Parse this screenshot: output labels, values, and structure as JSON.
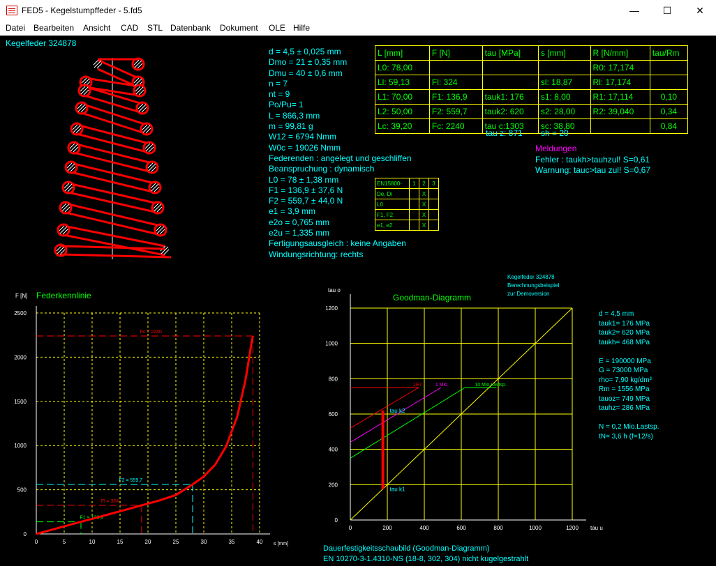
{
  "window": {
    "title": "FED5  -  Kegelstumpffeder  -  5.fd5",
    "minimize_glyph": "—",
    "maximize_glyph": "☐",
    "close_glyph": "✕"
  },
  "menu": [
    {
      "label": "Datei",
      "accel": "D"
    },
    {
      "label": "Bearbeiten",
      "accel": "B"
    },
    {
      "label": "Ansicht",
      "accel": "A"
    },
    {
      "label": "CAD",
      "accel": "C"
    },
    {
      "label": "STL",
      "accel": "S"
    },
    {
      "label": "Datenbank",
      "accel": ""
    },
    {
      "label": "Dokument",
      "accel": "D"
    },
    {
      "label": "OLE",
      "accel": "E"
    },
    {
      "label": "Hilfe",
      "accel": "H"
    }
  ],
  "spring_title": "Kegelfeder  324878",
  "results": [
    "d = 4,5 ± 0,025 mm",
    "Dmo = 21 ± 0,35 mm",
    "Dmu = 40 ± 0,6 mm",
    "n = 7",
    "nt = 9",
    "Po/Pu= 1",
    "L = 866,3 mm",
    "m = 99,81 g",
    "W12 = 6794 Nmm",
    "W0c = 19026 Nmm",
    "Federenden : angelegt und geschliffen",
    "Beanspruchung : dynamisch",
    "L0 = 78 ± 1,38 mm",
    "F1 = 136,9 ± 37,6 N",
    "F2 = 559,7 ± 44,0 N",
    "e1 = 3,9 mm",
    "e2o = 0,765 mm",
    "e2u = 1,335 mm",
    "Fertigungsausgleich : keine Angaben",
    "Windungsrichtung: rechts"
  ],
  "result_table": {
    "header": [
      "L [mm]",
      "F [N]",
      "tau [MPa]",
      "s [mm]",
      "R [N/mm]",
      "tau/Rm"
    ],
    "rows": [
      [
        "L0: 78,00",
        "",
        "",
        "",
        "R0: 17,174",
        ""
      ],
      [
        "Ll: 59,13",
        "Fl: 324",
        "",
        "sl:  18,87",
        "Rl: 17,174",
        ""
      ],
      [
        "L1: 70,00",
        "F1: 136,9",
        "tauk1: 176",
        "s1:   8,00",
        "R1: 17,114",
        "0,10"
      ],
      [
        "L2:  50,00",
        "F2: 559,7",
        "tauk2: 620",
        "s2:  28,00",
        "R2: 39,040",
        "0,34"
      ],
      [
        "Lc: 39,20",
        "Fc: 2240",
        "tau c:1303",
        "sc:  38,80",
        "",
        "0,84"
      ]
    ],
    "tau_z": "tau z: 871",
    "sh": "sh = 20"
  },
  "messages": {
    "title": "Meldungen",
    "lines": [
      "Fehler : taukh>tauhzul! S=0,61",
      "Warnung: tauc>tau zul! S=0,67"
    ]
  },
  "en_table": {
    "header": [
      "EN15800-",
      "1",
      "2",
      "3"
    ],
    "rows": [
      [
        "De, Di",
        "",
        "X",
        ""
      ],
      [
        "L0",
        "",
        "X",
        ""
      ],
      [
        "F1, F2",
        "",
        "X",
        ""
      ],
      [
        "e1, e2",
        "",
        "X",
        ""
      ]
    ]
  },
  "colors": {
    "background": "#000000",
    "cyan": "#00ffff",
    "yellow": "#ffff00",
    "green": "#00ff00",
    "red": "#ff0000",
    "magenta": "#ff00ff"
  },
  "chart_data": [
    {
      "type": "line",
      "title": "Federkennlinie",
      "xlabel": "s [mm]",
      "ylabel": "F [N]",
      "xlim": [
        0,
        40
      ],
      "ylim": [
        0,
        2500
      ],
      "xticks": [
        0,
        5,
        10,
        15,
        20,
        25,
        30,
        35,
        40
      ],
      "yticks": [
        0,
        500,
        1000,
        1500,
        2000,
        2500
      ],
      "grid": true,
      "series": [
        {
          "color": "#ff0000",
          "x": [
            0,
            4,
            8,
            12,
            16,
            18.87,
            22,
            25,
            28,
            30,
            32,
            34,
            36,
            37.5,
            38.5,
            38.8
          ],
          "values": [
            0,
            68.7,
            136.9,
            205,
            274,
            324,
            378,
            440,
            559.7,
            650,
            780,
            990,
            1330,
            1750,
            2140,
            2240
          ]
        }
      ],
      "markers": [
        {
          "label": "F1 = 136,9",
          "y": 136.9,
          "x": 8.0,
          "color": "#00ff00"
        },
        {
          "label": "Fl = 324",
          "y": 324,
          "x": 18.87,
          "color": "#ff0000"
        },
        {
          "label": "F2 = 559,7",
          "y": 559.7,
          "x": 28.0,
          "color": "#00ffff"
        },
        {
          "label": "Fc = 2240",
          "y": 2240,
          "x": 38.8,
          "color": "#ff0000"
        }
      ]
    },
    {
      "type": "line",
      "title": "Goodman-Diagramm",
      "xlabel": "tau u",
      "ylabel": "tau o",
      "xlim": [
        0,
        1200
      ],
      "ylim": [
        0,
        1200
      ],
      "xticks": [
        0,
        200,
        400,
        600,
        800,
        1000,
        1200
      ],
      "yticks": [
        0,
        200,
        400,
        600,
        800,
        1000,
        1200
      ],
      "grid": true,
      "series": [
        {
          "name": "1E7",
          "color": "#ff0000",
          "x": [
            0,
            370
          ],
          "values": [
            520,
            750
          ]
        },
        {
          "name": "1 Mio.",
          "color": "#ff00ff",
          "x": [
            0,
            490
          ],
          "values": [
            440,
            750
          ]
        },
        {
          "name": "10 Mio.Lastsp.",
          "color": "#00ff00",
          "x": [
            0,
            620,
            790
          ],
          "values": [
            350,
            750,
            750
          ]
        }
      ],
      "diagonal": {
        "x": [
          0,
          1200
        ],
        "values": [
          0,
          1200
        ],
        "color": "#ffff00"
      },
      "stress_line": {
        "x": [
          176,
          176
        ],
        "values": [
          176,
          620
        ],
        "color": "#ff0000"
      },
      "annotations": [
        {
          "label": "tau k2",
          "x": 176,
          "y": 620
        },
        {
          "label": "tau k1",
          "x": 176,
          "y": 176
        }
      ],
      "header_lines": [
        "Kegelfeder   324878",
        "Berechnungsbeispiel",
        "zur Demoversion"
      ],
      "footer_lines": [
        "Dauerfestigkeitsschaubild (Goodman-Diagramm)",
        "EN 10270-3-1.4310-NS (18-8, 302, 304) nicht kugelgestrahlt"
      ]
    }
  ],
  "material": [
    "d  = 4,5 mm",
    "tauk1=  176 MPa",
    "tauk2=  620 MPa",
    "taukh=  468 MPa",
    "",
    "E = 190000 MPa",
    "G =  73000 MPa",
    "rho=  7,90 kg/dm³",
    "Rm =  1556 MPa",
    "tauoz=  749 MPa",
    "tauhz=  286 MPa",
    "",
    "N = 0,2 Mio.Lastsp.",
    "tN= 3,6 h  (f=12/s)"
  ]
}
